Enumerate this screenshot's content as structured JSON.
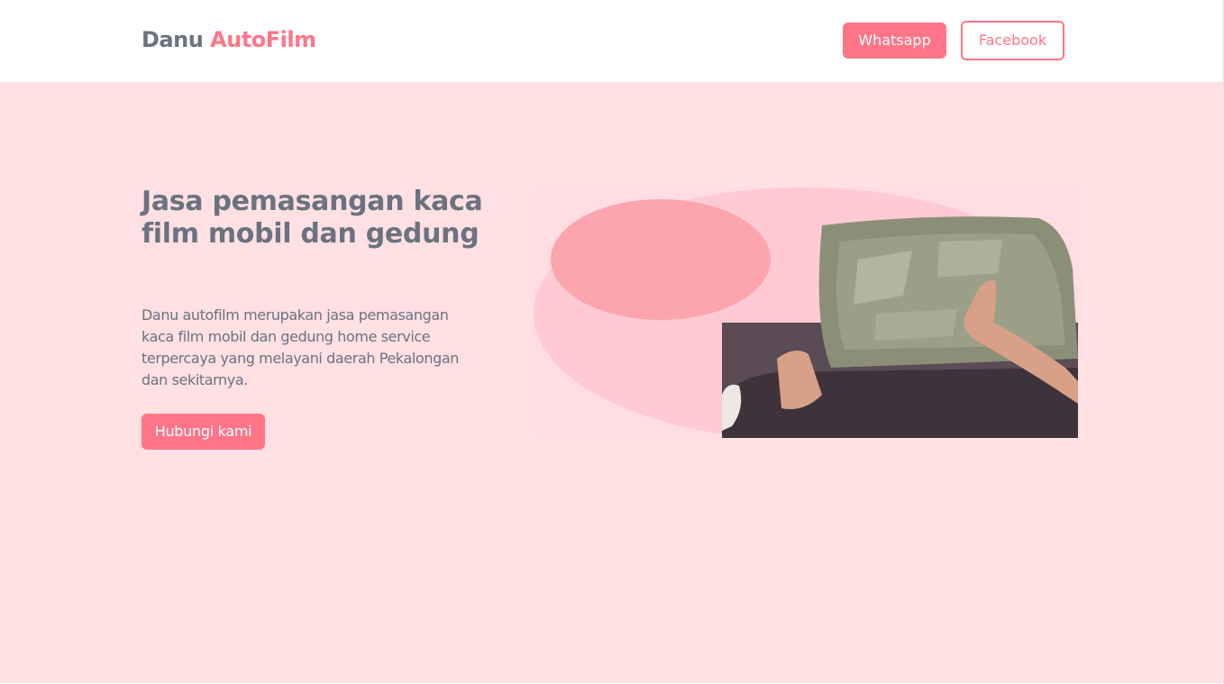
{
  "header": {
    "logo_primary": "Danu",
    "logo_accent": "AutoFilm",
    "whatsapp_label": "Whatsapp",
    "facebook_label": "Facebook"
  },
  "hero": {
    "title": "Jasa pemasangan kaca film mobil dan gedung",
    "description": "Danu autofilm merupakan jasa pemasangan kaca film mobil dan gedung home service terpercaya yang melayani daerah Pekalongan dan sekitarnya.",
    "cta_label": "Hubungi kami"
  },
  "colors": {
    "accent": "#ff7588",
    "text": "#6b7280",
    "hero_background": "#ffe0e3",
    "blob_large": "#ffcad4",
    "blob_small": "#fca5ae"
  }
}
